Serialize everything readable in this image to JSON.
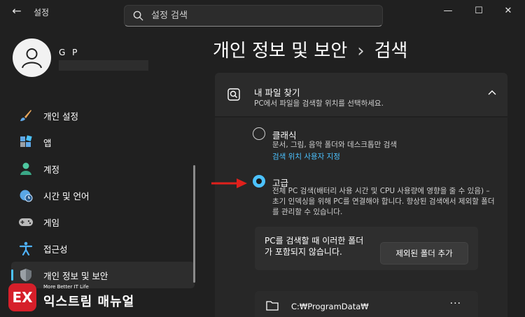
{
  "window": {
    "title": "설정",
    "back_glyph": "←",
    "minimize_glyph": "—",
    "maximize_glyph": "☐",
    "close_glyph": "✕"
  },
  "search": {
    "placeholder": "설정 검색",
    "icon": "search-icon"
  },
  "profile": {
    "name": "G P",
    "email": ""
  },
  "sidebar": {
    "items": [
      {
        "label": "개인 설정",
        "icon": "paintbrush-icon",
        "color": "#e8a65c"
      },
      {
        "label": "앱",
        "icon": "apps-icon",
        "color": "#60a8e8"
      },
      {
        "label": "계정",
        "icon": "person-icon",
        "color": "#4ec7a0"
      },
      {
        "label": "시간 및 언어",
        "icon": "globe-clock-icon",
        "color": "#5aa7e6"
      },
      {
        "label": "게임",
        "icon": "gamepad-icon",
        "color": "#b9b9b9"
      },
      {
        "label": "접근성",
        "icon": "accessibility-icon",
        "color": "#4fb3ff"
      },
      {
        "label": "개인 정보 및 보안",
        "icon": "shield-icon",
        "color": "#9aa0a6",
        "active": true
      }
    ]
  },
  "page": {
    "breadcrumb_parent": "개인 정보 및 보안",
    "breadcrumb_sep": "›",
    "breadcrumb_current": "검색"
  },
  "find_files": {
    "title": "내 파일 찾기",
    "subtitle": "PC에서 파일을 검색할 위치를 선택하세요.",
    "options": [
      {
        "title": "클래식",
        "desc": "문서, 그림, 음악 폴더와 데스크톱만 검색",
        "link": "검색 위치 사용자 지정",
        "selected": false
      },
      {
        "title": "고급",
        "desc": "전체 PC 검색(배터리 사용 시간 및 CPU 사용량에 영향을 줄 수 있음) – 초기 인덱싱을 위해 PC를 연결해야 합니다. 향상된 검색에서 제외할 폴더를 관리할 수 있습니다.",
        "selected": true
      }
    ]
  },
  "excluded": {
    "message": "PC를 검색할 때 이러한 폴더가 포함되지 않습니다.",
    "button_label": "제외된 폴더 추가",
    "folders": [
      {
        "path": "C:₩ProgramData₩",
        "more": "···"
      }
    ]
  },
  "colors": {
    "accent": "#4cc2ff",
    "arrow": "#e0201c",
    "background": "#202020",
    "watermark": "#d61f2a"
  },
  "watermark": {
    "logo": "EX",
    "sub": "More Better IT Life",
    "main": "익스트림 매뉴얼"
  }
}
